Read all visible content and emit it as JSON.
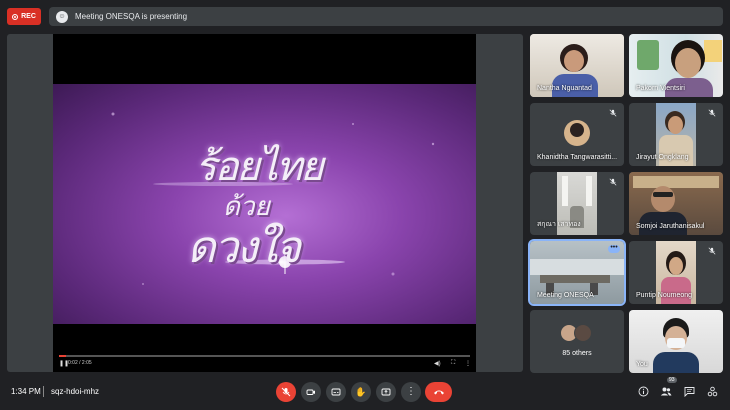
{
  "topbar": {
    "rec_label": "REC",
    "presenting_text": "Meeting ONESQA is presenting"
  },
  "video": {
    "title_line1": "ร้อยไทย",
    "title_line2": "ด้วย",
    "title_line3": "ดวงใจ",
    "time": "0:02 / 2:05",
    "progress": 0.016
  },
  "participants": [
    {
      "name": "Nantha Nguantad",
      "muted": false
    },
    {
      "name": "Pakorn Vientsiri",
      "muted": false
    },
    {
      "name": "Khanidtha Tangwarasitti...",
      "muted": true
    },
    {
      "name": "Jirayut Ongklang",
      "muted": true
    },
    {
      "name": "สกุณา เสาทอง",
      "muted": true
    },
    {
      "name": "Somjoi Jaruthanisakul",
      "muted": false
    },
    {
      "name": "Meeting ONESQA",
      "muted": false,
      "pinned": true
    },
    {
      "name": "Puntip Noumeong",
      "muted": true
    },
    {
      "name": "85 others",
      "muted": false
    },
    {
      "name": "You",
      "muted": false
    }
  ],
  "bottombar": {
    "time": "1:34 PM",
    "separator": "|",
    "meeting_code": "sqz-hdoi-mhz",
    "people_count": "93"
  },
  "colors": {
    "rec": "#d93025",
    "end_call": "#ea4335",
    "accent": "#8ab4f8",
    "surface": "#3c4043",
    "background": "#202124"
  }
}
